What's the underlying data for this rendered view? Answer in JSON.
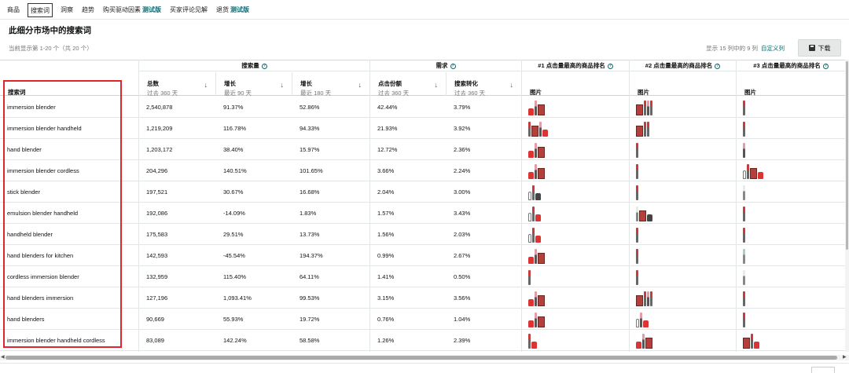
{
  "tabs": [
    {
      "label": "商品",
      "beta": ""
    },
    {
      "label": "搜索词",
      "beta": ""
    },
    {
      "label": "洞察",
      "beta": ""
    },
    {
      "label": "趋势",
      "beta": ""
    },
    {
      "label": "购买驱动因素",
      "beta": "测试版"
    },
    {
      "label": "买家评论见解",
      "beta": ""
    },
    {
      "label": "退货",
      "beta": "测试版"
    }
  ],
  "page_title": "此细分市场中的搜索词",
  "subtitle": "当前显示第 1-20 个（共 20 个）",
  "showing_columns": "显示 15 列中的 9 列",
  "customize_columns": "自定义列",
  "download_label": "下载",
  "groups": {
    "search_volume": "搜索量",
    "demand": "需求",
    "rank1": "#1 点击量最高的商品排名",
    "rank2": "#2 点击量最高的商品排名",
    "rank3": "#3 点击量最高的商品排名"
  },
  "columns": {
    "term": "搜索词",
    "total": {
      "l1": "总数",
      "l2": "过去 360 天"
    },
    "growth90": {
      "l1": "增长",
      "l2": "最近 90 天"
    },
    "growth180": {
      "l1": "增长",
      "l2": "最近 180 天"
    },
    "click_share": {
      "l1": "点击份额",
      "l2": "过去 360 天"
    },
    "conversion": {
      "l1": "搜索转化",
      "l2": "过去 360 天"
    },
    "image": "图片"
  },
  "sort_arrow": "↓",
  "info_mark": "?",
  "rows": [
    {
      "term": "immersion blender",
      "total": "2,540,878",
      "g90": "91.37%",
      "g180": "52.86%",
      "click": "42.44%",
      "conv": "3.79%"
    },
    {
      "term": "immersion blender handheld",
      "total": "1,219,209",
      "g90": "116.78%",
      "g180": "94.33%",
      "click": "21.93%",
      "conv": "3.92%"
    },
    {
      "term": "hand blender",
      "total": "1,203,172",
      "g90": "38.40%",
      "g180": "15.97%",
      "click": "12.72%",
      "conv": "2.36%"
    },
    {
      "term": "immersion blender cordless",
      "total": "204,296",
      "g90": "140.51%",
      "g180": "101.65%",
      "click": "3.66%",
      "conv": "2.24%"
    },
    {
      "term": "stick blender",
      "total": "197,521",
      "g90": "30.67%",
      "g180": "16.68%",
      "click": "2.04%",
      "conv": "3.00%"
    },
    {
      "term": "emulsion blender handheld",
      "total": "192,086",
      "g90": "-14.09%",
      "g180": "1.83%",
      "click": "1.57%",
      "conv": "3.43%"
    },
    {
      "term": "handheld blender",
      "total": "175,583",
      "g90": "29.51%",
      "g180": "13.73%",
      "click": "1.56%",
      "conv": "2.03%"
    },
    {
      "term": "hand blenders for kitchen",
      "total": "142,593",
      "g90": "-45.54%",
      "g180": "194.37%",
      "click": "0.99%",
      "conv": "2.67%"
    },
    {
      "term": "cordless immersion blender",
      "total": "132,959",
      "g90": "115.40%",
      "g180": "64.11%",
      "click": "1.41%",
      "conv": "0.50%"
    },
    {
      "term": "hand blenders immersion",
      "total": "127,196",
      "g90": "1,093.41%",
      "g180": "99.53%",
      "click": "3.15%",
      "conv": "3.56%"
    },
    {
      "term": "hand blenders",
      "total": "90,669",
      "g90": "55.93%",
      "g180": "19.72%",
      "click": "0.76%",
      "conv": "1.04%"
    },
    {
      "term": "immersion blender handheld cordless",
      "total": "83,089",
      "g90": "142.24%",
      "g180": "58.58%",
      "click": "1.26%",
      "conv": "2.39%"
    }
  ],
  "colors": {
    "accent": "#0a6b73",
    "highlight": "#e0262d"
  }
}
